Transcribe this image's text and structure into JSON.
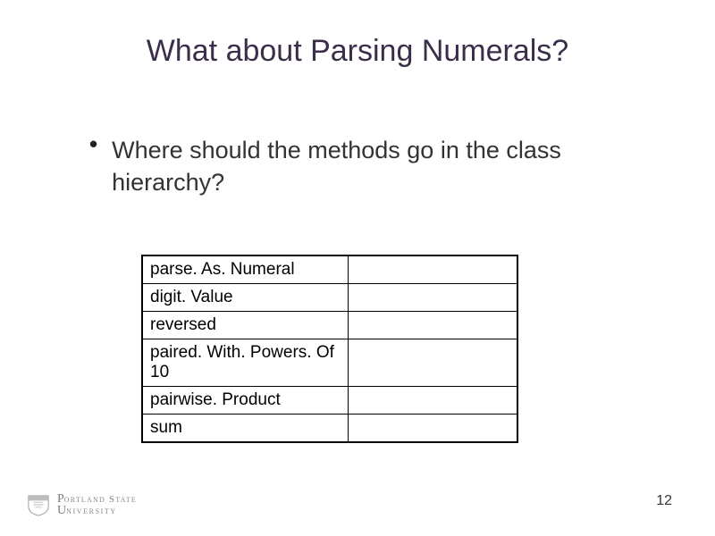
{
  "title": "What about Parsing Numerals?",
  "bullet": {
    "text": "Where should the methods go in the class hierarchy?"
  },
  "table": {
    "rows": [
      {
        "c1": "parse. As. Numeral",
        "c2": ""
      },
      {
        "c1": "digit. Value",
        "c2": ""
      },
      {
        "c1": "reversed",
        "c2": ""
      },
      {
        "c1": "paired. With. Powers. Of 10",
        "c2": ""
      },
      {
        "c1": "pairwise. Product",
        "c2": ""
      },
      {
        "c1": "sum",
        "c2": ""
      }
    ]
  },
  "footer": {
    "logo_line1": "Portland State",
    "logo_line2": "University",
    "page_number": "12"
  }
}
